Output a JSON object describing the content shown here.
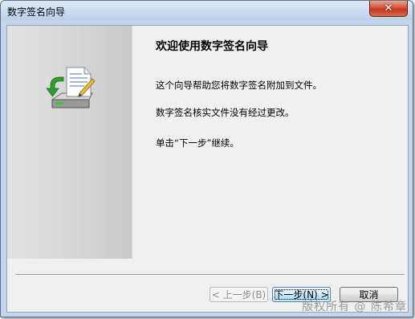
{
  "window": {
    "title": "数字签名向导",
    "close_glyph": "✕"
  },
  "content": {
    "heading": "欢迎使用数字签名向导",
    "paragraphs": [
      "这个向导帮助您将数字签名附加到文件。",
      "数字签名核实文件没有经过更改。",
      "单击“下一步”继续。"
    ]
  },
  "buttons": {
    "back": "< 上一步(B)",
    "next": "下一步(N) >",
    "cancel": "取消"
  },
  "icons": {
    "wizard": "document-with-green-arrow-into-drive-icon",
    "close": "close-icon"
  },
  "watermark": "版权所有 @ 陈希章",
  "colors": {
    "title_bar": "#cfdff3",
    "close_button": "#c4381f",
    "next_button_border": "#3c7fb1",
    "arrow_green": "#2f9e2f"
  }
}
